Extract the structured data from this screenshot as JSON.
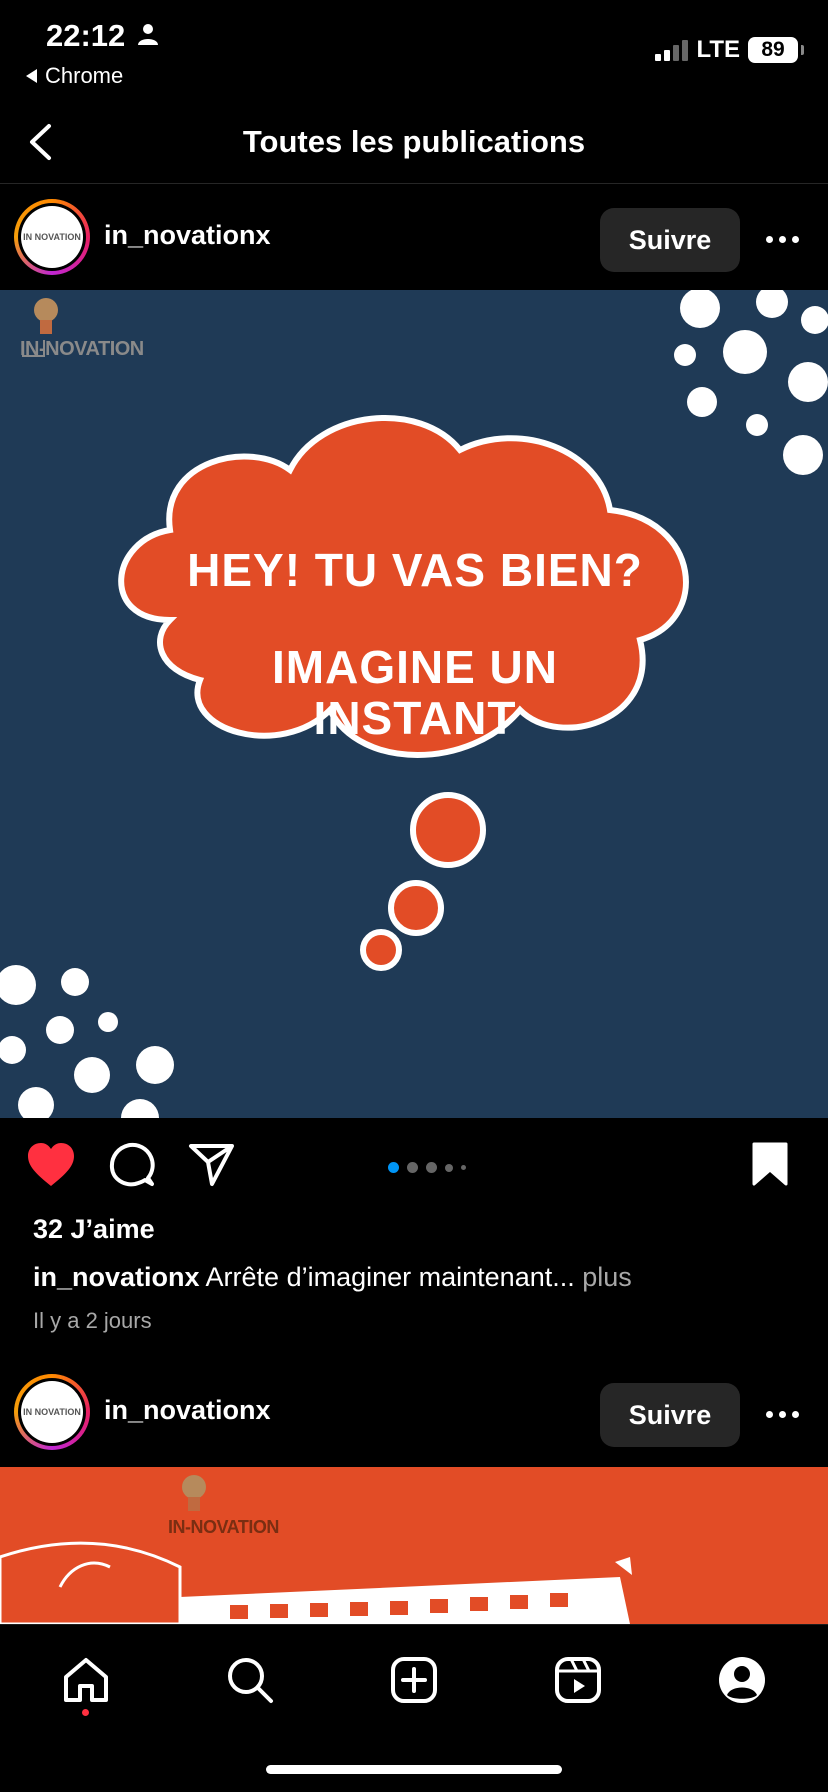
{
  "status_bar": {
    "time": "22:12",
    "back_app": "Chrome",
    "network": "LTE",
    "battery": "89"
  },
  "header": {
    "title": "Toutes les publications"
  },
  "posts": [
    {
      "username": "in_novationx",
      "follow_label": "Suivre",
      "avatar_text": "IN NOVATION",
      "image_brand": "IN-NOVATION",
      "image_text_line1": "HEY! TU VAS BIEN?",
      "image_text_line2": "IMAGINE UN",
      "image_text_line3": "INSTANT",
      "carousel": {
        "count": 5,
        "active": 0
      },
      "liked": true,
      "likes": "32 J’aime",
      "caption_user": "in_novationx",
      "caption_text": "Arrête d’imaginer maintenant...",
      "caption_more": "plus",
      "time_ago": "Il y a 2 jours"
    },
    {
      "username": "in_novationx",
      "follow_label": "Suivre",
      "avatar_text": "IN NOVATION",
      "image_brand": "IN-NOVATION"
    }
  ],
  "bottom_nav": {
    "items": [
      "home-icon",
      "search-icon",
      "create-icon",
      "reels-icon",
      "profile-icon"
    ],
    "active": "home-icon"
  },
  "colors": {
    "background": "#000000",
    "post1_bg": "#1f3a56",
    "cloud": "#e24c26",
    "post2_bg": "#e24c26",
    "like": "#ff3040",
    "carousel_active": "#0095f6"
  }
}
